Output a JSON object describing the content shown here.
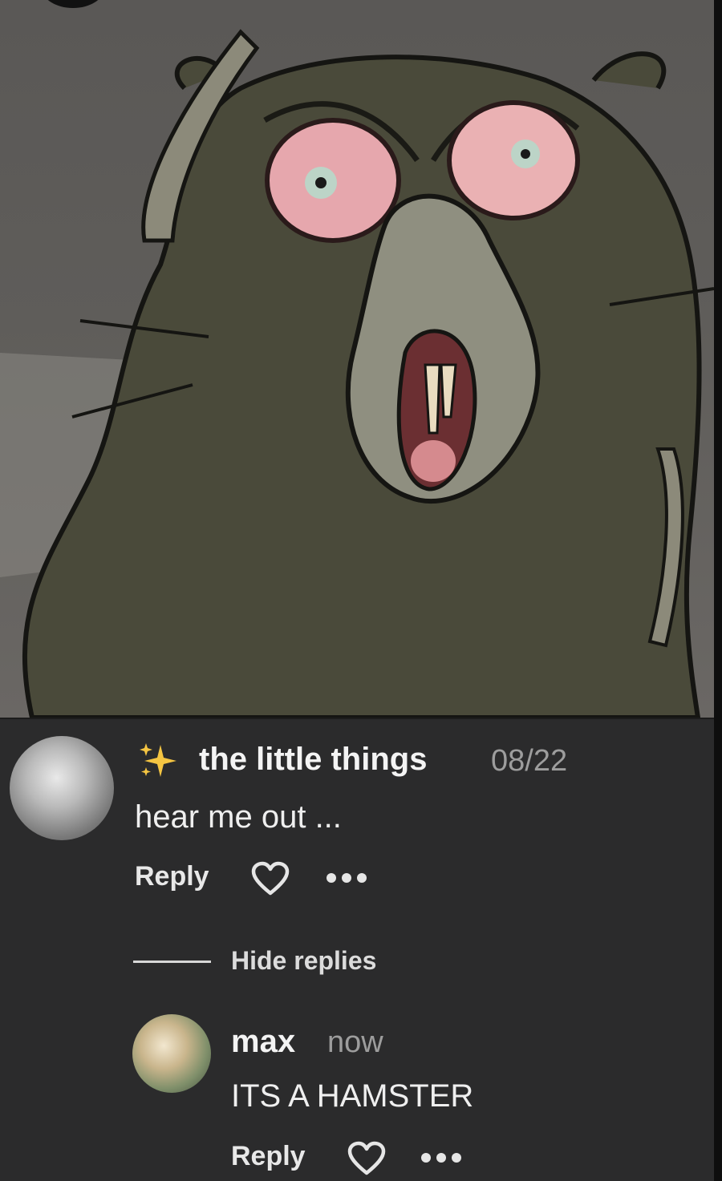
{
  "post": {
    "image_icon": "cartoon-hamster-image"
  },
  "comments": [
    {
      "username_prefix_icon": "sparkles-icon",
      "username": "the little things",
      "timestamp": "08/22",
      "text": "hear me out ...",
      "reply_label": "Reply"
    }
  ],
  "replies_toggle": {
    "label": "Hide replies"
  },
  "replies": [
    {
      "username": "max",
      "timestamp": "now",
      "text": "ITS A HAMSTER",
      "reply_label": "Reply"
    }
  ]
}
